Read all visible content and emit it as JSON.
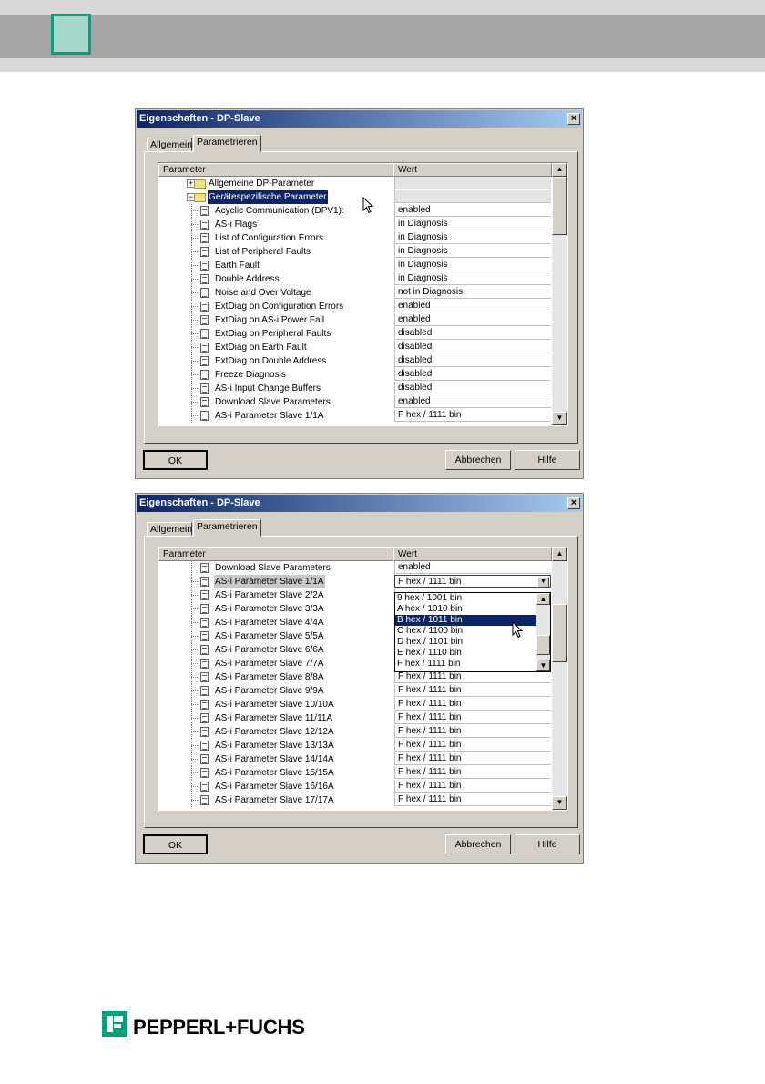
{
  "colors": {
    "accent_green": "#00a37a",
    "band_grey": "#a6a6a6",
    "selection": "#0a246a"
  },
  "dialog_top": {
    "title": "Eigenschaften - DP-Slave",
    "tabs": [
      "Allgemein",
      "Parametrieren"
    ],
    "headers": {
      "parameter": "Parameter",
      "wert": "Wert"
    },
    "groups": [
      {
        "label": "Allgemeine DP-Parameter",
        "fold": "+"
      },
      {
        "label": "Gerätespezifische Parameter",
        "fold": "−"
      }
    ],
    "rows": [
      {
        "label": "Acyclic Communication (DPV1):",
        "value": "enabled"
      },
      {
        "label": "AS-i Flags",
        "value": "in Diagnosis"
      },
      {
        "label": "List of Configuration Errors",
        "value": "in Diagnosis"
      },
      {
        "label": "List of Peripheral Faults",
        "value": "in Diagnosis"
      },
      {
        "label": "Earth Fault",
        "value": "in Diagnosis"
      },
      {
        "label": "Double Address",
        "value": "in Diagnosis"
      },
      {
        "label": "Noise and Over Voltage",
        "value": "not in Diagnosis"
      },
      {
        "label": "ExtDiag on Configuration Errors",
        "value": "enabled"
      },
      {
        "label": "ExtDiag on AS-i Power Fail",
        "value": "enabled"
      },
      {
        "label": "ExtDiag on Peripheral Faults",
        "value": "disabled"
      },
      {
        "label": "ExtDiag on Earth Fault",
        "value": "disabled"
      },
      {
        "label": "ExtDiag on Double Address",
        "value": "disabled"
      },
      {
        "label": "Freeze Diagnosis",
        "value": "disabled"
      },
      {
        "label": "AS-i Input Change Buffers",
        "value": "disabled"
      },
      {
        "label": "Download Slave Parameters",
        "value": "enabled"
      },
      {
        "label": "AS-i Parameter Slave 1/1A",
        "value": "F hex / 1111 bin"
      }
    ],
    "buttons": {
      "ok": "OK",
      "cancel": "Abbrechen",
      "help": "Hilfe"
    }
  },
  "dialog_bottom": {
    "title": "Eigenschaften - DP-Slave",
    "tabs": [
      "Allgemein",
      "Parametrieren"
    ],
    "headers": {
      "parameter": "Parameter",
      "wert": "Wert"
    },
    "rows": [
      {
        "label": "Download Slave Parameters",
        "value": "enabled"
      },
      {
        "label": "AS-i Parameter Slave 1/1A",
        "value": "F hex / 1111 bin"
      },
      {
        "label": "AS-i Parameter Slave 2/2A",
        "value": ""
      },
      {
        "label": "AS-i Parameter Slave 3/3A",
        "value": ""
      },
      {
        "label": "AS-i Parameter Slave 4/4A",
        "value": ""
      },
      {
        "label": "AS-i Parameter Slave 5/5A",
        "value": ""
      },
      {
        "label": "AS-i Parameter Slave 6/6A",
        "value": ""
      },
      {
        "label": "AS-i Parameter Slave 7/7A",
        "value": ""
      },
      {
        "label": "AS-i Parameter Slave 8/8A",
        "value": "F hex / 1111 bin"
      },
      {
        "label": "AS-i Parameter Slave 9/9A",
        "value": "F hex / 1111 bin"
      },
      {
        "label": "AS-i Parameter Slave 10/10A",
        "value": "F hex / 1111 bin"
      },
      {
        "label": "AS-i Parameter Slave 11/11A",
        "value": "F hex / 1111 bin"
      },
      {
        "label": "AS-i Parameter Slave 12/12A",
        "value": "F hex / 1111 bin"
      },
      {
        "label": "AS-i Parameter Slave 13/13A",
        "value": "F hex / 1111 bin"
      },
      {
        "label": "AS-i Parameter Slave 14/14A",
        "value": "F hex / 1111 bin"
      },
      {
        "label": "AS-i Parameter Slave 15/15A",
        "value": "F hex / 1111 bin"
      },
      {
        "label": "AS-i Parameter Slave 16/16A",
        "value": "F hex / 1111 bin"
      },
      {
        "label": "AS-i Parameter Slave 17/17A",
        "value": "F hex / 1111 bin"
      }
    ],
    "dropdown_options": [
      "9 hex / 1001 bin",
      "A hex / 1010 bin",
      "B hex / 1011 bin",
      "C hex / 1100 bin",
      "D hex / 1101 bin",
      "E hex / 1110 bin",
      "F hex / 1111 bin"
    ],
    "dropdown_selected": "B hex / 1011 bin",
    "buttons": {
      "ok": "OK",
      "cancel": "Abbrechen",
      "help": "Hilfe"
    }
  },
  "footer": {
    "brand": "PEPPERL+FUCHS"
  }
}
